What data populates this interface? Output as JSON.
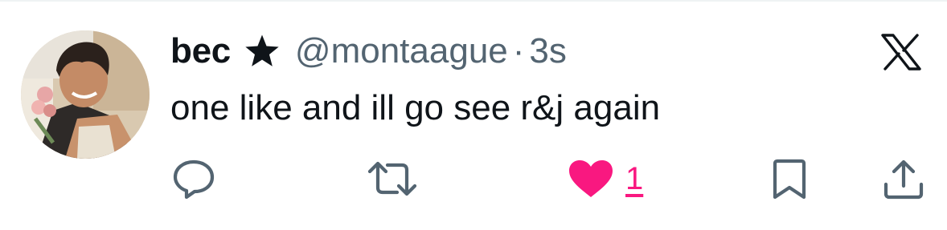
{
  "tweet": {
    "display_name": "bec",
    "handle": "@montaague",
    "separator": "·",
    "timestamp": "3s",
    "text": "one like and ill go see r&j again"
  },
  "actions": {
    "like_count": "1",
    "liked": true
  },
  "icons": {
    "verified": "star-icon",
    "brand": "x-logo-icon",
    "reply": "reply-icon",
    "retweet": "retweet-icon",
    "like": "heart-icon",
    "bookmark": "bookmark-icon",
    "share": "share-icon"
  },
  "colors": {
    "text_primary": "#0f1419",
    "text_secondary": "#536471",
    "like_accent": "#f91880"
  }
}
